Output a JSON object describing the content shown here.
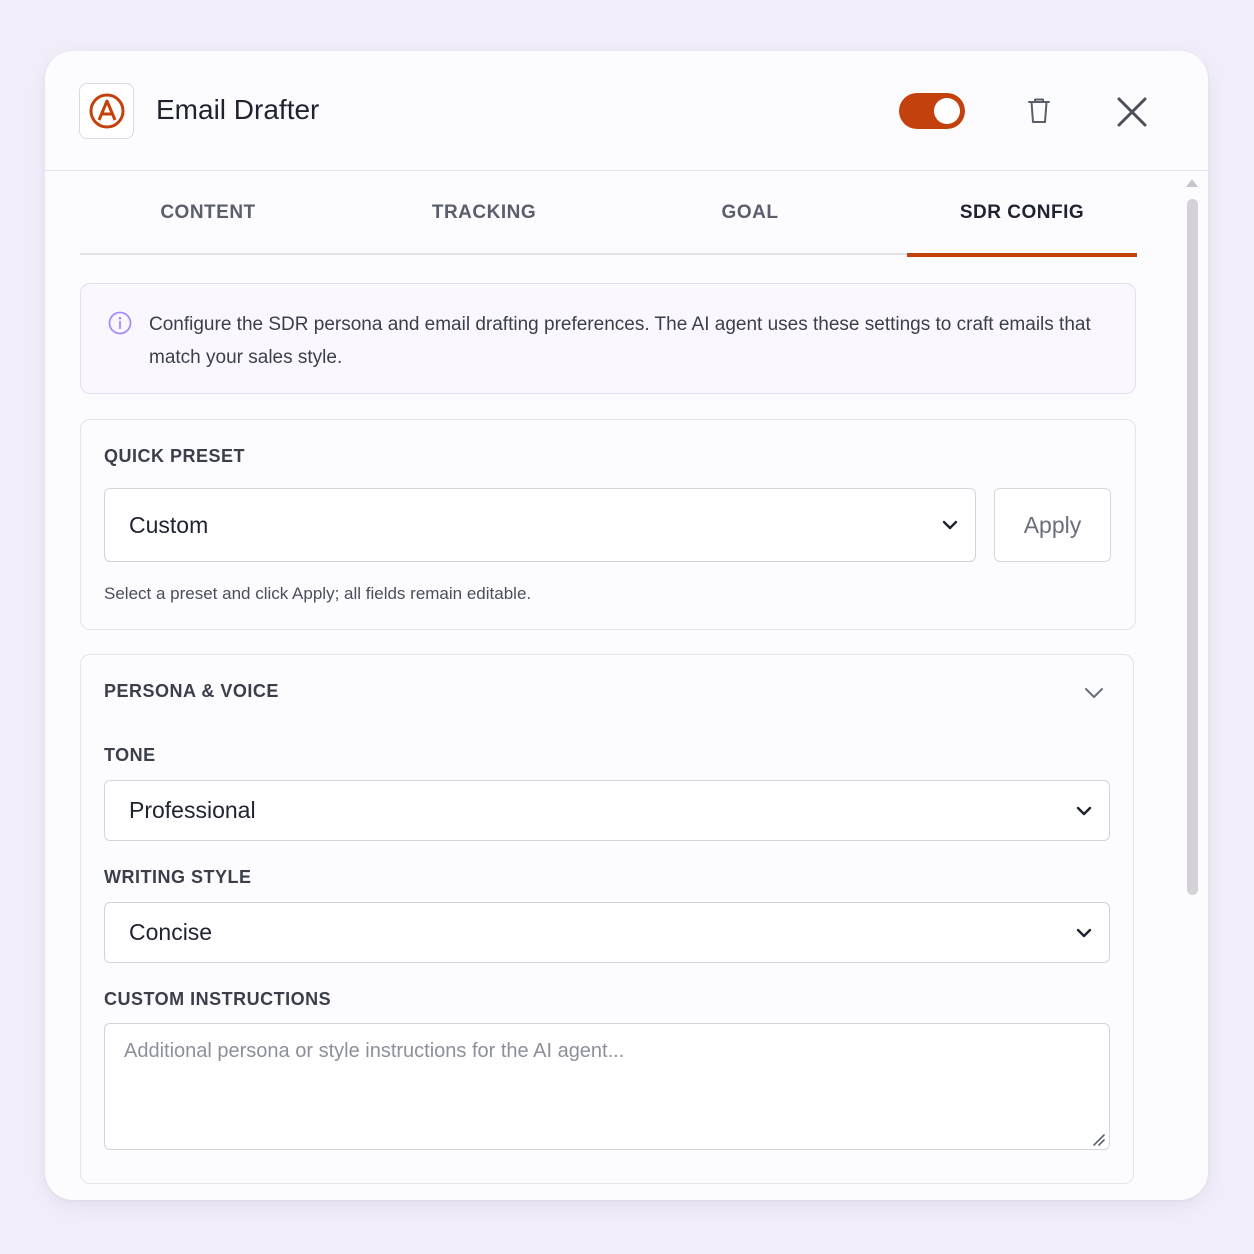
{
  "header": {
    "title": "Email Drafter",
    "enabled": true,
    "accent_color": "#c2410c"
  },
  "tabs": [
    {
      "label": "CONTENT",
      "active": false
    },
    {
      "label": "TRACKING",
      "active": false
    },
    {
      "label": "GOAL",
      "active": false
    },
    {
      "label": "SDR CONFIG",
      "active": true
    }
  ],
  "info": {
    "text": "Configure the SDR persona and email drafting preferences. The AI agent uses these settings to craft emails that match your sales style."
  },
  "quick_preset": {
    "label": "QUICK PRESET",
    "selected": "Custom",
    "apply_label": "Apply",
    "helper": "Select a preset and click Apply; all fields remain editable."
  },
  "persona": {
    "section_label": "PERSONA & VOICE",
    "tone_label": "TONE",
    "tone_value": "Professional",
    "style_label": "WRITING STYLE",
    "style_value": "Concise",
    "instructions_label": "CUSTOM INSTRUCTIONS",
    "instructions_placeholder": "Additional persona or style instructions for the AI agent..."
  },
  "icons": {
    "logo": "anthropic-a-logo-icon",
    "trash": "trash-icon",
    "close": "close-icon",
    "info": "info-icon",
    "chevron": "chevron-down-icon"
  }
}
